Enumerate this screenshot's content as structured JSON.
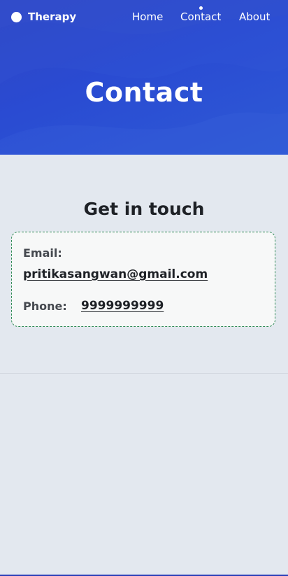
{
  "nav": {
    "brand": "Therapy",
    "links": [
      {
        "label": "Home",
        "active": false
      },
      {
        "label": "Contact",
        "active": true
      },
      {
        "label": "About",
        "active": false
      }
    ]
  },
  "hero": {
    "title": "Contact"
  },
  "contact": {
    "heading": "Get in touch",
    "email_label": "Email:",
    "email": "pritikasangwan@gmail.com",
    "phone_label": "Phone:",
    "phone": "9999999999"
  },
  "colors": {
    "hero_bg": "#2d4ccf",
    "page_bg": "#e3e8ef",
    "card_bg": "#f7f8f8",
    "card_border": "#2f8a55"
  }
}
